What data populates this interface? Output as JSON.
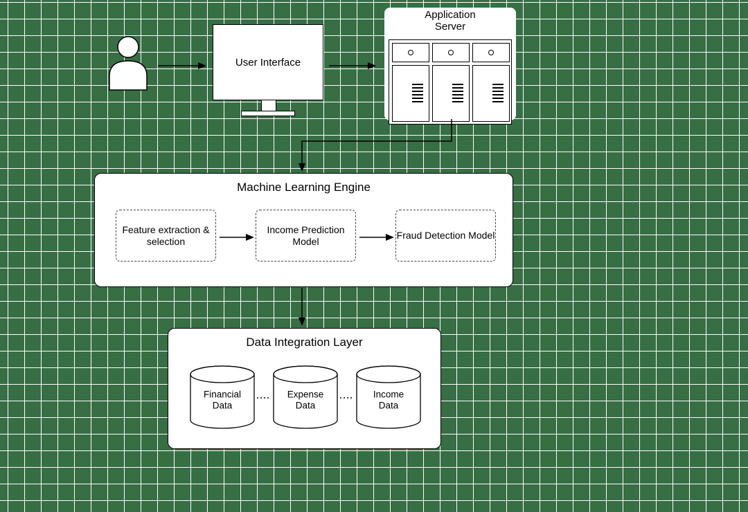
{
  "top": {
    "user_interface": "User Interface",
    "app_server_title": "Application",
    "app_server_title2": "Server"
  },
  "ml_panel": {
    "title": "Machine Learning Engine",
    "feature_box": "Feature extraction & selection",
    "income_box": "Income Prediction Model",
    "fraud_box": "Fraud Detection Model"
  },
  "data_panel": {
    "title": "Data Integration Layer",
    "db1a": "Financial",
    "db1b": "Data",
    "db2a": "Expense",
    "db2b": "Data",
    "db3a": "Income",
    "db3b": "Data"
  }
}
